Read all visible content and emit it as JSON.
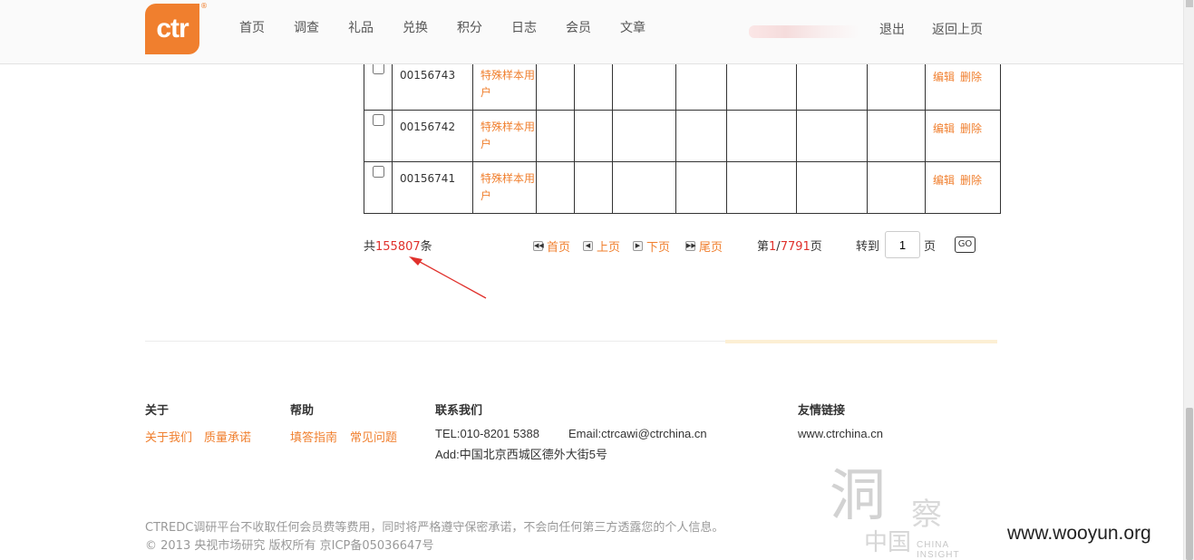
{
  "header": {
    "logo_text": "ctr",
    "logo_mark": "®",
    "nav": [
      "首页",
      "调查",
      "礼品",
      "兑换",
      "积分",
      "日志",
      "会员",
      "文章"
    ],
    "logout": "退出",
    "back": "返回上页"
  },
  "table": {
    "rows": [
      {
        "id": "00156743",
        "type": "特殊样本用户",
        "edit": "编辑",
        "delete": "删除"
      },
      {
        "id": "00156742",
        "type": "特殊样本用户",
        "edit": "编辑",
        "delete": "删除"
      },
      {
        "id": "00156741",
        "type": "特殊样本用户",
        "edit": "编辑",
        "delete": "删除"
      }
    ]
  },
  "pager": {
    "total_prefix": "共",
    "total_count": "155807",
    "total_suffix": "条",
    "first": "首页",
    "prev": "上页",
    "next": "下页",
    "last": "尾页",
    "page_prefix": "第",
    "current_page": "1",
    "page_sep": "/",
    "total_pages": "7791",
    "page_suffix": "页",
    "goto_label": "转到",
    "goto_value": "1",
    "goto_unit": "页",
    "go_label": "GO"
  },
  "footer": {
    "about_title": "关于",
    "about_links": [
      "关于我们",
      "质量承诺"
    ],
    "help_title": "帮助",
    "help_links": [
      "填答指南",
      "常见问题"
    ],
    "contact_title": "联系我们",
    "tel": "TEL:010-8201 5388",
    "email": "Email:ctrcawi@ctrchina.cn",
    "address": "Add:中国北京西城区德外大街5号",
    "friends_title": "友情链接",
    "friend_link": "www.ctrchina.cn",
    "notice": "CTREDC调研平台不收取任何会员费等费用，同时将严格遵守保密承诺，不会向任何第三方透露您的个人信息。",
    "copyright": "© 2013 央视市场研究 版权所有 京ICP备05036647号"
  },
  "watermarks": {
    "seal_main": "洞",
    "seal_sub": "察",
    "seal_cn": "中国",
    "seal_en": "CHINA INSIGHT",
    "site": "www.wooyun.org"
  },
  "colors": {
    "accent": "#f07f2e",
    "highlight": "#e0302b",
    "arrow": "#e0302b"
  }
}
